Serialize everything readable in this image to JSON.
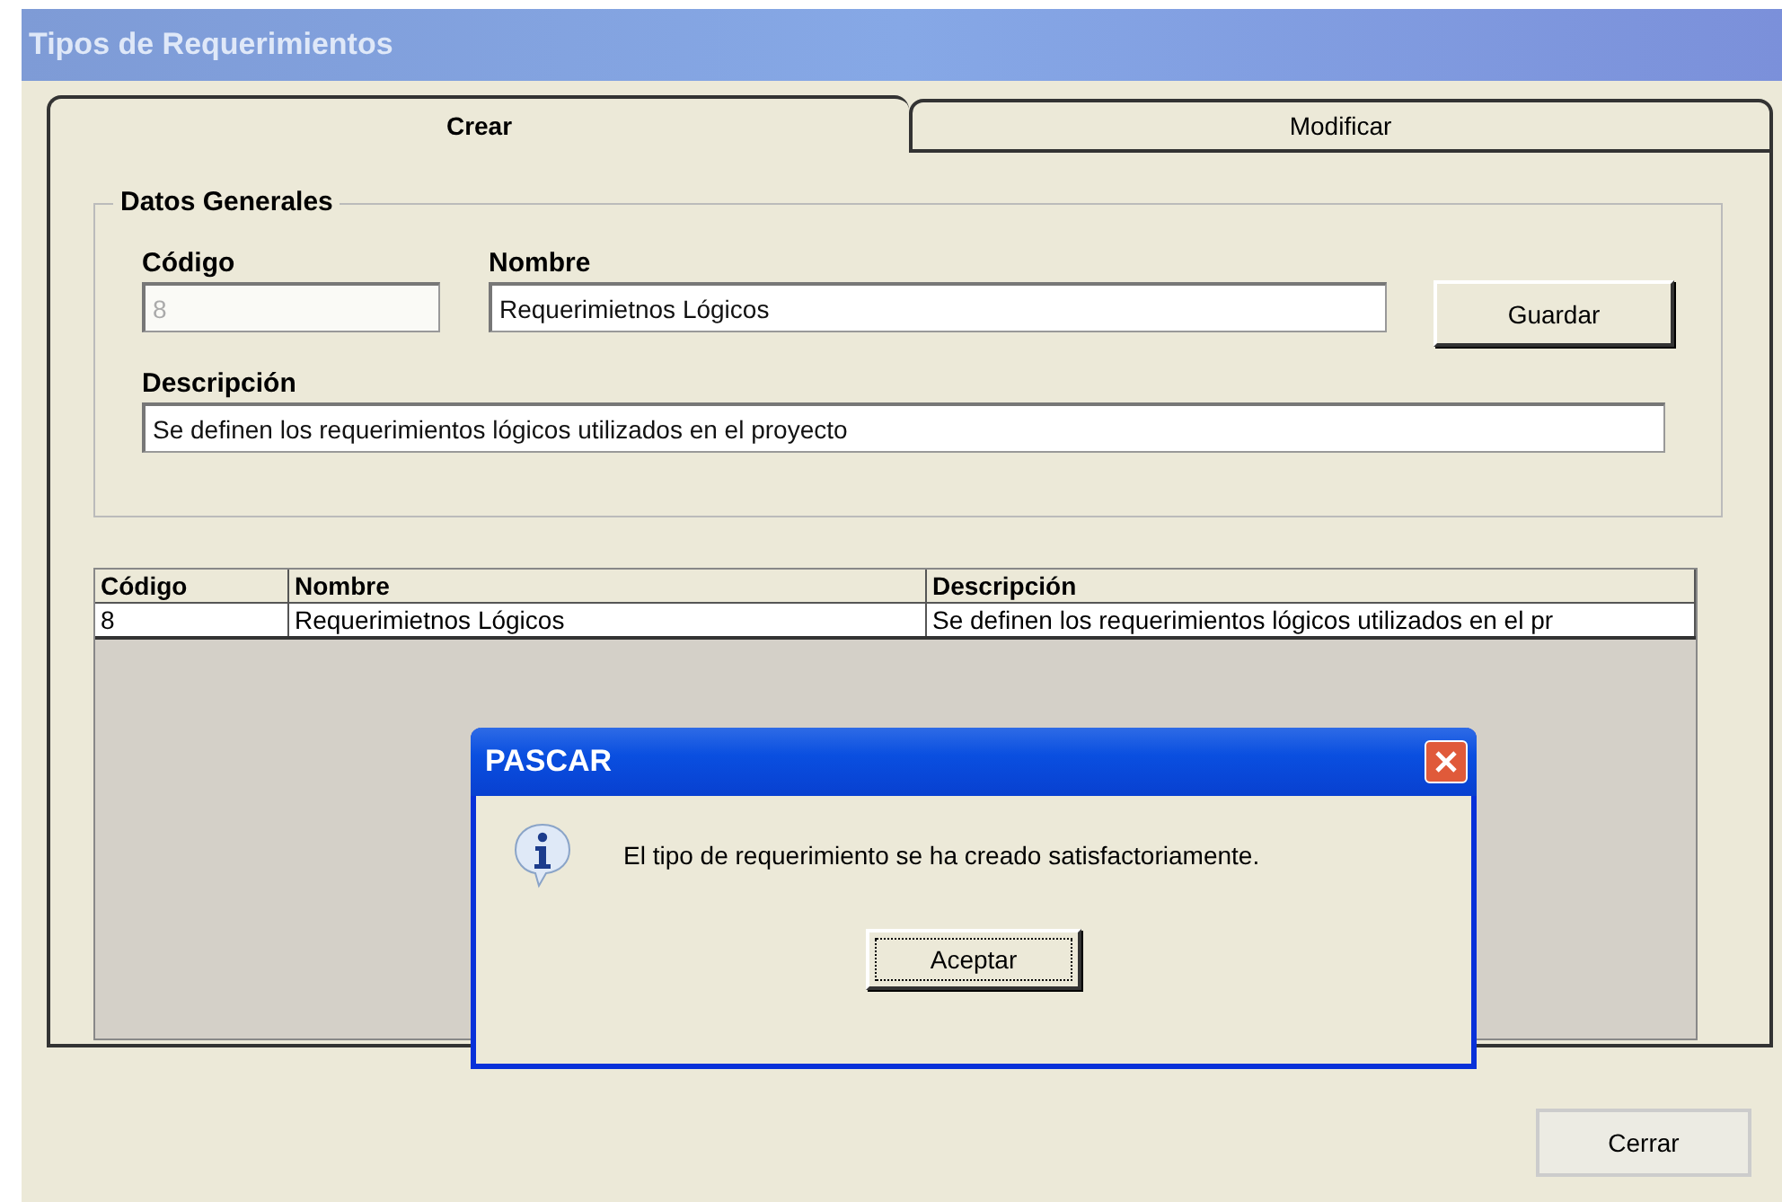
{
  "window": {
    "title": "Tipos de Requerimientos"
  },
  "tabs": [
    {
      "label": "Crear",
      "selected": true
    },
    {
      "label": "Modificar",
      "selected": false
    }
  ],
  "group": {
    "title": "Datos Generales",
    "fields": [
      {
        "label": "Código",
        "value": "8",
        "disabled": true
      },
      {
        "label": "Nombre",
        "value": "Requerimietnos Lógicos",
        "disabled": false
      },
      {
        "label": "Descripción",
        "value": "Se definen los requerimientos lógicos utilizados en el proyecto",
        "disabled": false
      }
    ],
    "save_button": "Guardar"
  },
  "table": {
    "columns": [
      "Código",
      "Nombre",
      "Descripción"
    ],
    "rows": [
      [
        "8",
        "Requerimietnos Lógicos",
        "Se definen los requerimientos lógicos utilizados en el pr"
      ]
    ]
  },
  "dialog": {
    "title": "PASCAR",
    "message": "El tipo de requerimiento se ha creado satisfactoriamente.",
    "button": "Aceptar"
  },
  "close_button": "Cerrar"
}
